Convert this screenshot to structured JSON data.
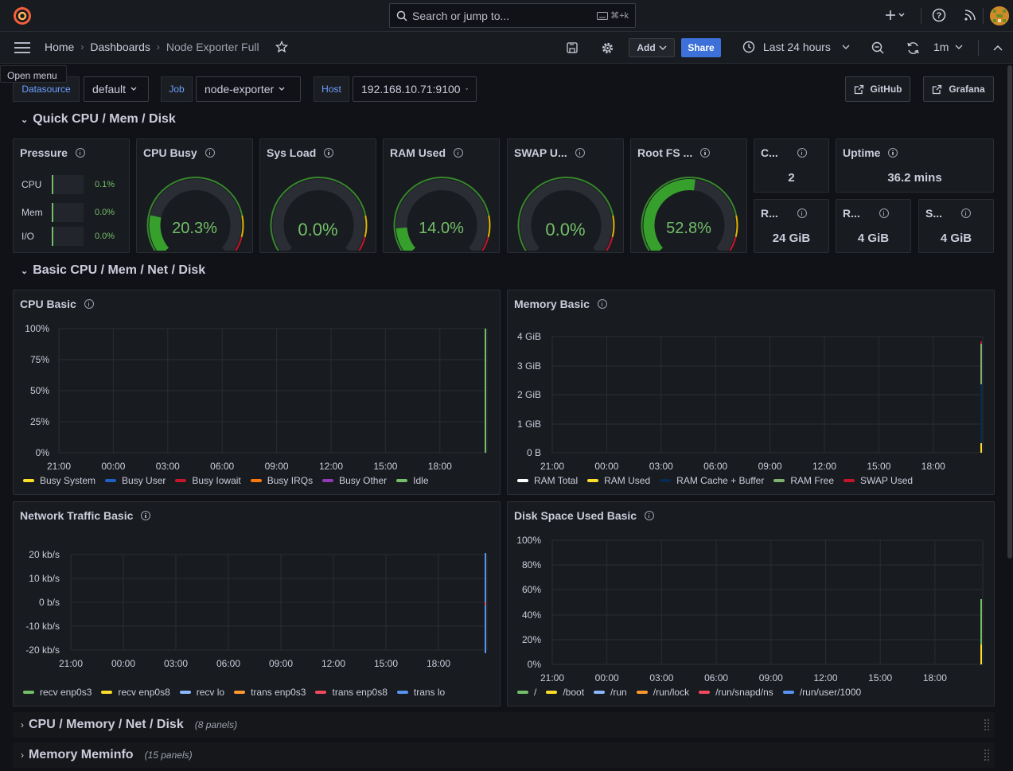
{
  "search": {
    "placeholder": "Search or jump to...",
    "shortcut": "⌘+k"
  },
  "tooltip": "Open menu",
  "breadcrumb": {
    "home": "Home",
    "dashboards": "Dashboards",
    "current": "Node Exporter Full"
  },
  "toolbar": {
    "add": "Add",
    "share": "Share",
    "time_range": "Last 24 hours",
    "refresh": "1m"
  },
  "variables": [
    {
      "label": "Datasource",
      "value": "default"
    },
    {
      "label": "Job",
      "value": "node-exporter"
    },
    {
      "label": "Host",
      "value": "192.168.10.71:9100"
    }
  ],
  "links": {
    "github": "GitHub",
    "grafana": "Grafana"
  },
  "rows": {
    "quick": "Quick CPU / Mem / Disk",
    "basic": "Basic CPU / Mem / Net / Disk",
    "collapsed": [
      {
        "title": "CPU / Memory / Net / Disk",
        "count": "(8 panels)"
      },
      {
        "title": "Memory Meminfo",
        "count": "(15 panels)"
      }
    ]
  },
  "pressure": {
    "title": "Pressure",
    "items": [
      {
        "label": "CPU",
        "value": "0.1%"
      },
      {
        "label": "Mem",
        "value": "0.0%"
      },
      {
        "label": "I/O",
        "value": "0.0%"
      }
    ]
  },
  "gauges": [
    {
      "title": "CPU Busy",
      "value": "20.3%",
      "level": 0.203
    },
    {
      "title": "Sys Load",
      "value": "0.0%",
      "level": 0
    },
    {
      "title": "RAM Used",
      "value": "14.0%",
      "level": 0.14
    },
    {
      "title": "SWAP U...",
      "value": "0.0%",
      "level": 0
    },
    {
      "title": "Root FS ...",
      "value": "52.8%",
      "level": 0.528
    }
  ],
  "stats": [
    {
      "title": "C...",
      "value": "2"
    },
    {
      "title": "Uptime",
      "value": "36.2 mins"
    },
    {
      "title": "R...",
      "value": "24 GiB"
    },
    {
      "title": "R...",
      "value": "4 GiB"
    },
    {
      "title": "S...",
      "value": "4 GiB"
    }
  ],
  "panels": {
    "cpu": {
      "title": "CPU Basic",
      "yticks": [
        "100%",
        "75%",
        "50%",
        "25%",
        "0%"
      ],
      "legend": [
        {
          "name": "Busy System",
          "color": "#fade2a"
        },
        {
          "name": "Busy User",
          "color": "#1f60c4"
        },
        {
          "name": "Busy Iowait",
          "color": "#c4162a"
        },
        {
          "name": "Busy IRQs",
          "color": "#ff780a"
        },
        {
          "name": "Busy Other",
          "color": "#8f3bb8"
        },
        {
          "name": "Idle",
          "color": "#73bf69"
        }
      ]
    },
    "mem": {
      "title": "Memory Basic",
      "yticks": [
        "4 GiB",
        "3 GiB",
        "2 GiB",
        "1 GiB",
        "0 B"
      ],
      "legend": [
        {
          "name": "RAM Total",
          "color": "#ffffff"
        },
        {
          "name": "RAM Used",
          "color": "#fade2a"
        },
        {
          "name": "RAM Cache + Buffer",
          "color": "#052b51"
        },
        {
          "name": "RAM Free",
          "color": "#7eb26d"
        },
        {
          "name": "SWAP Used",
          "color": "#c4162a"
        }
      ]
    },
    "net": {
      "title": "Network Traffic Basic",
      "yticks": [
        "20 kb/s",
        "10 kb/s",
        "0 b/s",
        "-10 kb/s",
        "-20 kb/s"
      ],
      "legend": [
        {
          "name": "recv enp0s3",
          "color": "#73bf69"
        },
        {
          "name": "recv enp0s8",
          "color": "#fade2a"
        },
        {
          "name": "recv lo",
          "color": "#8ab8ff"
        },
        {
          "name": "trans enp0s3",
          "color": "#ff9830"
        },
        {
          "name": "trans enp0s8",
          "color": "#f2495c"
        },
        {
          "name": "trans lo",
          "color": "#5794f2"
        }
      ]
    },
    "disk": {
      "title": "Disk Space Used Basic",
      "yticks": [
        "100%",
        "80%",
        "60%",
        "40%",
        "20%",
        "0%"
      ],
      "legend": [
        {
          "name": "/",
          "color": "#73bf69"
        },
        {
          "name": "/boot",
          "color": "#fade2a"
        },
        {
          "name": "/run",
          "color": "#8ab8ff"
        },
        {
          "name": "/run/lock",
          "color": "#ff9830"
        },
        {
          "name": "/run/snapd/ns",
          "color": "#f2495c"
        },
        {
          "name": "/run/user/1000",
          "color": "#5794f2"
        }
      ]
    }
  },
  "xticks": [
    "21:00",
    "00:00",
    "03:00",
    "06:00",
    "09:00",
    "12:00",
    "15:00",
    "18:00"
  ]
}
